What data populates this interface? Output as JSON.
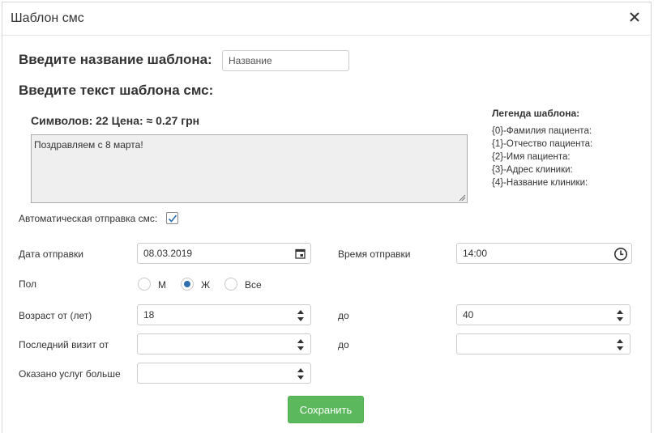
{
  "modal": {
    "title": "Шаблон смс"
  },
  "template_name": {
    "label": "Введите название шаблона:",
    "placeholder": "Название"
  },
  "template_text": {
    "label": "Введите текст шаблона смс:",
    "counter": "Символов: 22 Цена: ≈ 0.27 грн",
    "value": "Поздравляем с 8 марта!"
  },
  "legend": {
    "title": "Легенда шаблона:",
    "items": [
      "{0}-Фамилия пациента:",
      "{1}-Отчество пациента:",
      "{2}-Имя пациента:",
      "{3}-Адрес клиники:",
      "{4}-Название клиники:"
    ]
  },
  "auto_send": {
    "label": "Автоматическая отправка смс:",
    "checked": true
  },
  "send_date": {
    "label": "Дата отправки",
    "value": "08.03.2019"
  },
  "send_time": {
    "label": "Время отправки",
    "value": "14:00"
  },
  "gender": {
    "label": "Пол",
    "options": [
      "М",
      "Ж",
      "Все"
    ],
    "selected": "Ж"
  },
  "age": {
    "label_from": "Возраст от (лет)",
    "from": "18",
    "label_to": "до",
    "to": "40"
  },
  "last_visit": {
    "label_from": "Последний визит от",
    "from": "",
    "label_to": "до",
    "to": ""
  },
  "services": {
    "label": "Оказано услуг больше",
    "value": ""
  },
  "save_label": "Сохранить",
  "icons": [
    "close-icon",
    "calendar-icon",
    "clock-icon",
    "spinner-icon",
    "check-icon"
  ],
  "colors": {
    "accent": "#2f6fb0",
    "save": "#5cb85c"
  }
}
